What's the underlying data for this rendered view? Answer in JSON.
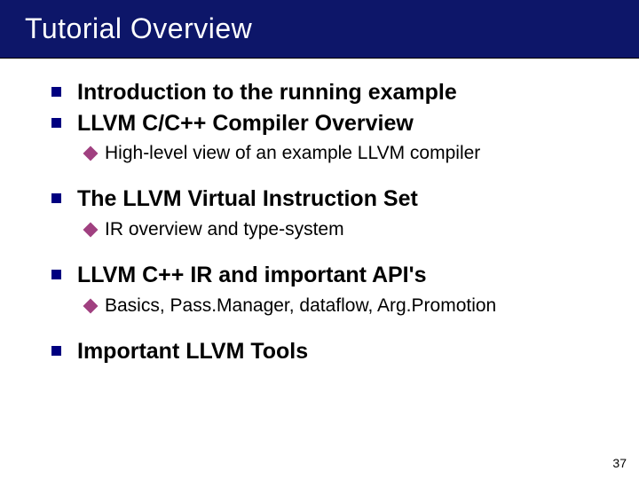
{
  "title": "Tutorial Overview",
  "items": {
    "0": {
      "text": "Introduction to the running example"
    },
    "1": {
      "text": "LLVM C/C++ Compiler Overview",
      "sub": {
        "0": {
          "text": "High-level view of an example LLVM compiler"
        }
      }
    },
    "2": {
      "text": "The LLVM Virtual Instruction Set",
      "sub": {
        "0": {
          "text": "IR overview and type-system"
        }
      }
    },
    "3": {
      "text": "LLVM C++ IR and important API's",
      "sub": {
        "0": {
          "text": "Basics, Pass.Manager, dataflow, Arg.Promotion"
        }
      }
    },
    "4": {
      "text": "Important LLVM Tools"
    }
  },
  "page_number": "37"
}
